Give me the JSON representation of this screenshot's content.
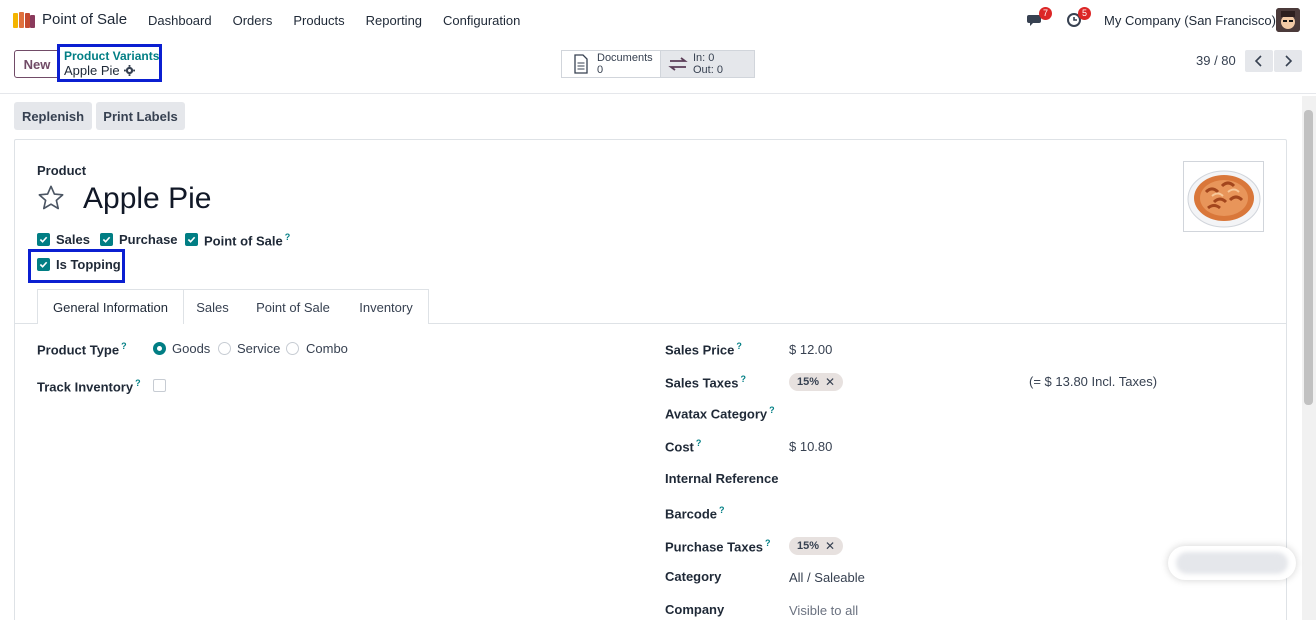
{
  "navbar": {
    "app_name": "Point of Sale",
    "menu": [
      "Dashboard",
      "Orders",
      "Products",
      "Reporting",
      "Configuration"
    ],
    "messages_count": "7",
    "activities_count": "5",
    "company": "My Company (San Francisco)"
  },
  "control_panel": {
    "new_label": "New",
    "breadcrumb_parent": "Product Variants",
    "breadcrumb_current": "Apple Pie",
    "documents_label": "Documents",
    "documents_count": "0",
    "in_label": "In: 0",
    "out_label": "Out: 0",
    "pager": "39 / 80"
  },
  "actions": {
    "replenish": "Replenish",
    "print_labels": "Print Labels"
  },
  "form": {
    "product_label": "Product",
    "name": "Apple Pie",
    "checkboxes": {
      "sales": "Sales",
      "purchase": "Purchase",
      "point_of_sale": "Point of Sale",
      "is_topping": "Is Topping"
    },
    "tabs": [
      "General Information",
      "Sales",
      "Point of Sale",
      "Inventory"
    ],
    "product_type_label": "Product Type",
    "product_type_options": [
      "Goods",
      "Service",
      "Combo"
    ],
    "track_inventory_label": "Track Inventory",
    "sales_price_label": "Sales Price",
    "sales_price": "$ 12.00",
    "sales_taxes_label": "Sales Taxes",
    "sales_tax_tag": "15%",
    "incl_taxes": "(= $ 13.80 Incl. Taxes)",
    "avatax_label": "Avatax Category",
    "cost_label": "Cost",
    "cost": "$ 10.80",
    "internal_ref_label": "Internal Reference",
    "barcode_label": "Barcode",
    "purchase_taxes_label": "Purchase Taxes",
    "purchase_tax_tag": "15%",
    "category_label": "Category",
    "category": "All / Saleable",
    "company_label": "Company",
    "company_placeholder": "Visible to all"
  },
  "colors": {
    "brand": "#714b67",
    "accent": "#017e84",
    "highlight": "#0b1fd1"
  }
}
